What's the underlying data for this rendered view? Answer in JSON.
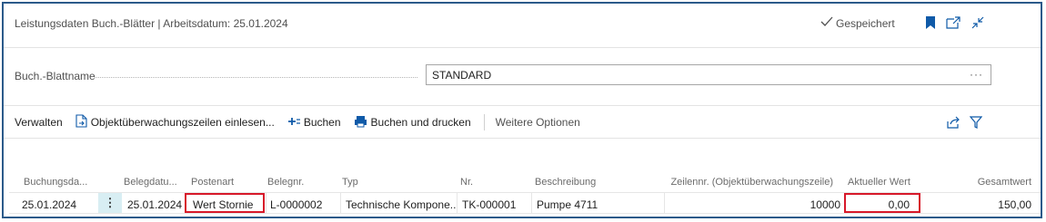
{
  "header": {
    "title": "Leistungsdaten Buch.-Blätter | Arbeitsdatum: 25.01.2024",
    "saved_status": "Gespeichert",
    "accent": "#0f5aa8"
  },
  "field": {
    "label": "Buch.-Blattname",
    "value": "STANDARD",
    "more": "···"
  },
  "actions": {
    "manage": "Verwalten",
    "fetch_lines": "Objektüberwachungszeilen einlesen...",
    "post": "Buchen",
    "post_print": "Buchen und drucken",
    "more_options": "Weitere Optionen"
  },
  "table": {
    "columns": [
      "Buchungsda...",
      "Belegdatu...",
      "Postenart",
      "Belegnr.",
      "Typ",
      "Nr.",
      "Beschreibung",
      "Zeilennr. (Objektüberwachungszeile)",
      "Aktueller Wert",
      "Gesamtwert"
    ],
    "row": {
      "posting_date": "25.01.2024",
      "doc_date": "25.01.2024",
      "entry_type": "Wert Stornie",
      "doc_no": "L-0000002",
      "type": "Technische Kompone...",
      "no": "TK-000001",
      "description": "Pumpe 4711",
      "line_no": "10000",
      "current_value": "0,00",
      "total_value": "150,00"
    },
    "highlight_color": "#d7182a"
  }
}
